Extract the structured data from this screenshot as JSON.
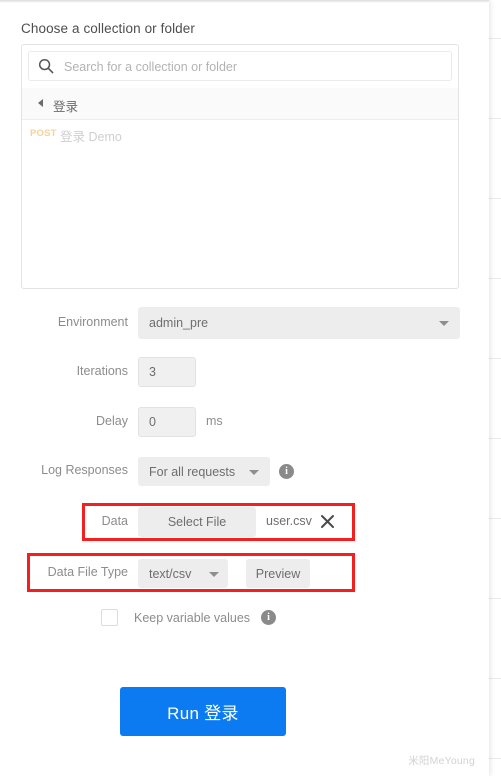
{
  "modal": {
    "title": "Choose a collection or folder",
    "search": {
      "placeholder": "Search for a collection or folder",
      "value": "",
      "icon": "search-icon"
    },
    "collection": {
      "name": "登录",
      "caret": "caret-left-icon",
      "requests": [
        {
          "method": "POST",
          "name": "登录 Demo"
        }
      ]
    }
  },
  "form": {
    "environment": {
      "label": "Environment",
      "value": "admin_pre",
      "caret": "chevron-down-icon"
    },
    "iterations": {
      "label": "Iterations",
      "value": "3"
    },
    "delay": {
      "label": "Delay",
      "value": "0",
      "unit": "ms"
    },
    "log_responses": {
      "label": "Log Responses",
      "value": "For all requests",
      "caret": "chevron-down-icon",
      "info": "i",
      "info_icon": "info-icon"
    },
    "data": {
      "label": "Data",
      "select_file_label": "Select File",
      "file_name": "user.csv",
      "clear_icon": "close-icon",
      "highlighted": true
    },
    "data_file_type": {
      "label": "Data File Type",
      "value": "text/csv",
      "caret": "chevron-down-icon",
      "preview_label": "Preview",
      "highlighted": true
    },
    "keep_variable_values": {
      "label": "Keep variable values",
      "checked": false,
      "info": "i",
      "info_icon": "info-icon"
    }
  },
  "run_button": {
    "label": "Run 登录"
  },
  "watermark": {
    "text": "米阳MeYoung"
  },
  "colors": {
    "accent_blue": "#0c7bf2",
    "highlight_red": "#f41f1f",
    "method_post": "#f7d29a",
    "control_grey": "#ededed",
    "label_grey": "#8c8c8c"
  }
}
